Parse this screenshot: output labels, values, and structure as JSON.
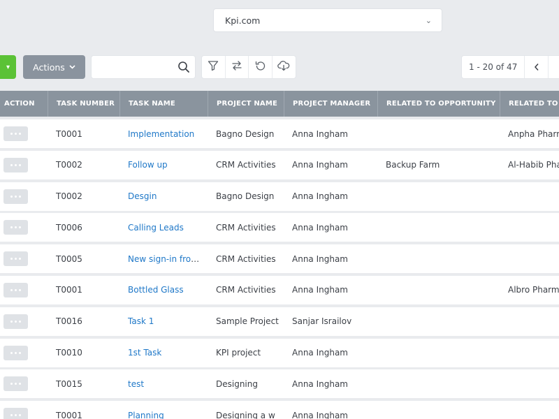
{
  "site_selector": {
    "value": "Kpi.com"
  },
  "toolbar": {
    "actions_label": "Actions",
    "search_placeholder": "",
    "pager_range": "1 - 20 of 47"
  },
  "table": {
    "columns": [
      "ACTION",
      "TASK NUMBER",
      "TASK NAME",
      "PROJECT NAME",
      "PROJECT MANAGER",
      "RELATED TO OPPORTUNITY",
      "RELATED TO A"
    ],
    "rows": [
      {
        "task_number": "T0001",
        "task_name": "Implementation",
        "project_name": "Bagno Design",
        "project_manager": "Anna Ingham",
        "related_opportunity": "",
        "related_account": "Anpha Pharm"
      },
      {
        "task_number": "T0002",
        "task_name": "Follow up",
        "project_name": "CRM Activities",
        "project_manager": "Anna Ingham",
        "related_opportunity": "Backup Farm",
        "related_account": "Al-Habib Pha"
      },
      {
        "task_number": "T0002",
        "task_name": "Desgin",
        "project_name": "Bagno Design",
        "project_manager": "Anna Ingham",
        "related_opportunity": "",
        "related_account": ""
      },
      {
        "task_number": "T0006",
        "task_name": "Calling Leads",
        "project_name": "CRM Activities",
        "project_manager": "Anna Ingham",
        "related_opportunity": "",
        "related_account": ""
      },
      {
        "task_number": "T0005",
        "task_name": "New sign-in from ...",
        "project_name": "CRM Activities",
        "project_manager": "Anna Ingham",
        "related_opportunity": "",
        "related_account": ""
      },
      {
        "task_number": "T0001",
        "task_name": "Bottled Glass",
        "project_name": "CRM Activities",
        "project_manager": "Anna Ingham",
        "related_opportunity": "",
        "related_account": "Albro Pharma"
      },
      {
        "task_number": "T0016",
        "task_name": "Task 1",
        "project_name": "Sample Project",
        "project_manager": "Sanjar Israilov",
        "related_opportunity": "",
        "related_account": ""
      },
      {
        "task_number": "T0010",
        "task_name": "1st Task",
        "project_name": "KPI project",
        "project_manager": "Anna Ingham",
        "related_opportunity": "",
        "related_account": ""
      },
      {
        "task_number": "T0015",
        "task_name": "test",
        "project_name": "Designing",
        "project_manager": "Anna Ingham",
        "related_opportunity": "",
        "related_account": ""
      },
      {
        "task_number": "T0001",
        "task_name": "Planning",
        "project_name": "Designing a w",
        "project_manager": "Anna Ingham",
        "related_opportunity": "",
        "related_account": ""
      }
    ]
  },
  "colors": {
    "accent_green": "#5bc236",
    "header_gray": "#8a949e",
    "link_blue": "#1f78c8"
  }
}
